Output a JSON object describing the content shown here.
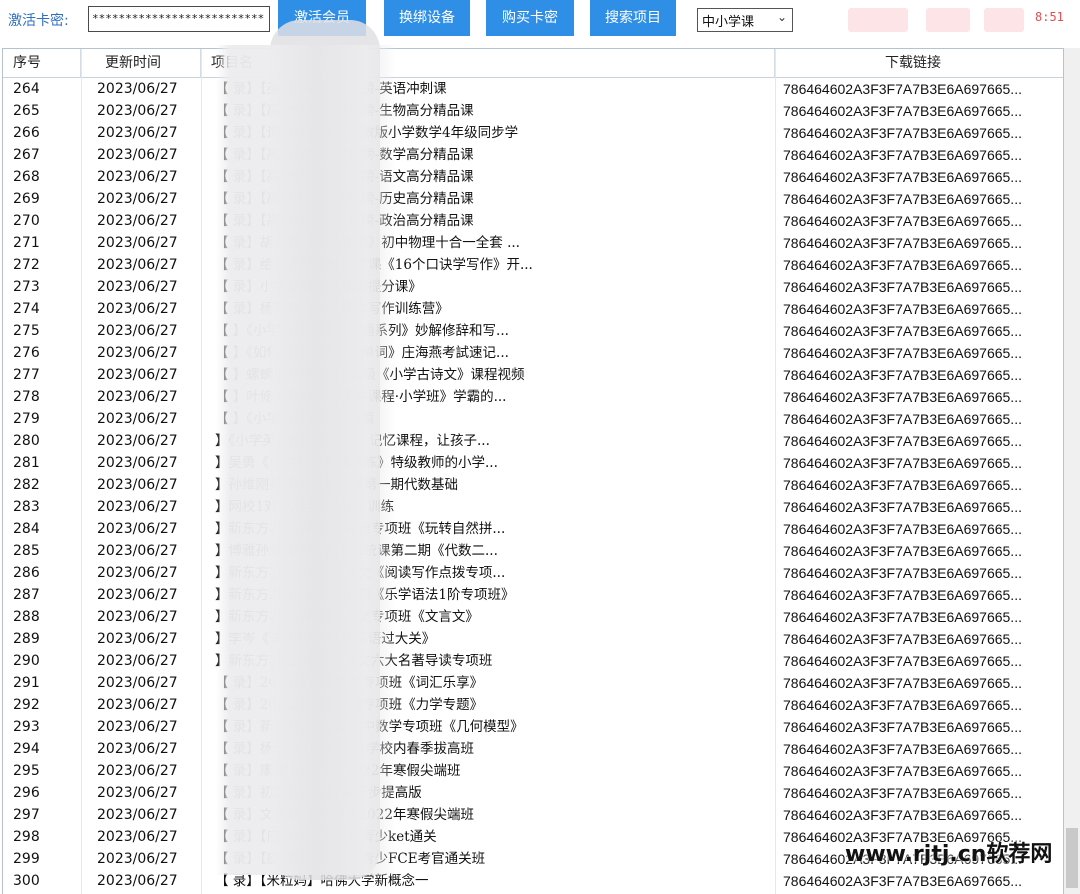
{
  "toolbar": {
    "card_label": "激活卡密:",
    "card_value": "**************************",
    "buttons": [
      "激活会员",
      "换绑设备",
      "购买卡密",
      "搜索项目"
    ],
    "category_selected": "中小学课",
    "clock": "8:51"
  },
  "table": {
    "headers": {
      "id": "序号",
      "date": "更新时间",
      "name": "项目名",
      "link": "下载链接"
    },
    "rows": [
      {
        "id": "264",
        "date": "2023/06/27",
        "name": "【                  录】【英语冲刺】学魁榜-英语冲刺课",
        "link": "786464602A3F3F7A7B3E6A697665..."
      },
      {
        "id": "265",
        "date": "2023/06/27",
        "name": "【                  录】【高分生物】学魁榜-生物高分精品课",
        "link": "786464602A3F3F7A7B3E6A697665..."
      },
      {
        "id": "266",
        "date": "2023/06/27",
        "name": "【                  录】【追你学】统编人教版小学数学4年级同步学",
        "link": "786464602A3F3F7A7B3E6A697665..."
      },
      {
        "id": "267",
        "date": "2023/06/27",
        "name": "【                  录】【高分数学】学魁榜-数学高分精品课",
        "link": "786464602A3F3F7A7B3E6A697665..."
      },
      {
        "id": "268",
        "date": "2023/06/27",
        "name": "【                  录】【高分语文】学魁榜-语文高分精品课",
        "link": "786464602A3F3F7A7B3E6A697665..."
      },
      {
        "id": "269",
        "date": "2023/06/27",
        "name": "【                  录】【高分历史】学魁榜-历史高分精品课",
        "link": "786464602A3F3F7A7B3E6A697665..."
      },
      {
        "id": "270",
        "date": "2023/06/27",
        "name": "【                  录】【高分政治】学魁榜-政治高分精品课",
        "link": "786464602A3F3F7A7B3E6A697665..."
      },
      {
        "id": "271",
        "date": "2023/06/27",
        "name": "【                  录】胡志强《中考物理》初中物理十合一全套 ...",
        "link": "786464602A3F3F7A7B3E6A697665..."
      },
      {
        "id": "272",
        "date": "2023/06/27",
        "name": "【                  录】给孩子的高分作文课《16个口诀学写作》开...",
        "link": "786464602A3F3F7A7B3E6A697665..."
      },
      {
        "id": "273",
        "date": "2023/06/27",
        "name": "【                  录】小学高年级《阅读提分课》",
        "link": "786464602A3F3F7A7B3E6A697665..."
      },
      {
        "id": "274",
        "date": "2023/06/27",
        "name": "【                  录】杨巧铃《中考散文写作训练营》",
        "link": "786464602A3F3F7A7B3E6A697665..."
      },
      {
        "id": "275",
        "date": "2023/06/27",
        "name": "【                   】《小学语文写作小灵通系列》妙解修辞和写...",
        "link": "786464602A3F3F7A7B3E6A697665..."
      },
      {
        "id": "276",
        "date": "2023/06/27",
        "name": "【                   】《如何快速记忆英语单词》庄海燕考試速记...",
        "link": "786464602A3F3F7A7B3E6A697665..."
      },
      {
        "id": "277",
        "date": "2023/06/27",
        "name": "【                   】螺蛳小学语文1-6年级《小学古诗文》课程视频",
        "link": "786464602A3F3F7A7B3E6A697665..."
      },
      {
        "id": "278",
        "date": "2023/06/27",
        "name": "【                   】叶修《深度学习策略课程·小学班》学霸的...",
        "link": "786464602A3F3F7A7B3E6A697665..."
      },
      {
        "id": "279",
        "date": "2023/06/27",
        "name": "【                   】《小学科学课》入门篇",
        "link": "786464602A3F3F7A7B3E6A697665..."
      },
      {
        "id": "280",
        "date": "2023/06/27",
        "name": "                     】《小学英语800个单词》记忆课程，让孩子...",
        "link": "786464602A3F3F7A7B3E6A697665..."
      },
      {
        "id": "281",
        "date": "2023/06/27",
        "name": "                     】吴勇《小学写作基础训练》特级教师的小学...",
        "link": "786464602A3F3F7A7B3E6A697665..."
      },
      {
        "id": "282",
        "date": "2023/06/27",
        "name": "                     】孙维刚数学初中系统课第一期代数基础",
        "link": "786464602A3F3F7A7B3E6A697665..."
      },
      {
        "id": "283",
        "date": "2023/06/27",
        "name": "                     】网校1对1小学作文分步训练",
        "link": "786464602A3F3F7A7B3E6A697665..."
      },
      {
        "id": "284",
        "date": "2023/06/27",
        "name": "                     】新东方2022春小学英语专项班《玩转自然拼...",
        "link": "786464602A3F3F7A7B3E6A697665..."
      },
      {
        "id": "285",
        "date": "2023/06/27",
        "name": "                     】博雅孙维刚数学初中系统课第二期《代数二...",
        "link": "786464602A3F3F7A7B3E6A697665..."
      },
      {
        "id": "286",
        "date": "2023/06/27",
        "name": "                     】新东方2022春小学语文《阅读写作点拨专项...",
        "link": "786464602A3F3F7A7B3E6A697665..."
      },
      {
        "id": "287",
        "date": "2023/06/27",
        "name": "                     】新东方2022春小学英语《乐学语法1阶专项班》",
        "link": "786464602A3F3F7A7B3E6A697665..."
      },
      {
        "id": "288",
        "date": "2023/06/27",
        "name": "                     】新东方2022春初中语文专项班《文言文》",
        "link": "786464602A3F3F7A7B3E6A697665..."
      },
      {
        "id": "289",
        "date": "2023/06/27",
        "name": "                     】李岑《李岑老师·小学英语过大关》",
        "link": "786464602A3F3F7A7B3E6A697665..."
      },
      {
        "id": "290",
        "date": "2023/06/27",
        "name": "                     】新东方2022春小学语文六大名著导读专项班",
        "link": "786464602A3F3F7A7B3E6A697665..."
      },
      {
        "id": "291",
        "date": "2023/06/27",
        "name": "【                  录】2022春初中英语专项班《词汇乐享》",
        "link": "786464602A3F3F7A7B3E6A697665..."
      },
      {
        "id": "292",
        "date": "2023/06/27",
        "name": "【                  录】2022春初中物理专项班《力学专题》",
        "link": "786464602A3F3F7A7B3E6A697665..."
      },
      {
        "id": "293",
        "date": "2023/06/27",
        "name": "【                  录】新东方2022春初中数学专项班《几何模型》",
        "link": "786464602A3F3F7A7B3E6A697665..."
      },
      {
        "id": "294",
        "date": "2023/06/27",
        "name": "【                  录】杨琦 2022初一数学校内春季拔高班",
        "link": "786464602A3F3F7A7B3E6A697665..."
      },
      {
        "id": "295",
        "date": "2023/06/27",
        "name": "【                  录】康冲 高一化学2022年寒假尖端班",
        "link": "786464602A3F3F7A7B3E6A697665..."
      },
      {
        "id": "296",
        "date": "2023/06/27",
        "name": "【                  录】初二政治人教版同步提高版",
        "link": "786464602A3F3F7A7B3E6A697665..."
      },
      {
        "id": "297",
        "date": "2023/06/27",
        "name": "【                  录】文旭刚 高一英语2022年寒假尖端班",
        "link": "786464602A3F3F7A7B3E6A697665..."
      },
      {
        "id": "298",
        "date": "2023/06/27",
        "name": "【                  录】【应试英语】北外青少ket通关",
        "link": "786464602A3F3F7A7B3E6A697665..."
      },
      {
        "id": "299",
        "date": "2023/06/27",
        "name": "【                  录】【应试英语】北外青少FCE考官通关班",
        "link": "786464602A3F3F7A7B3E6A697665..."
      },
      {
        "id": "300",
        "date": "2023/06/27",
        "name": "【                  录】【米粒妈】哈佛大学新概念一",
        "link": "786464602A3F3F7A7B3E6A697665..."
      }
    ]
  },
  "watermark": {
    "text": "www.rjtj.cn软荐网"
  },
  "colors": {
    "button": "#2f8ee6",
    "label": "#2f6fbf",
    "clock": "#e05050"
  }
}
